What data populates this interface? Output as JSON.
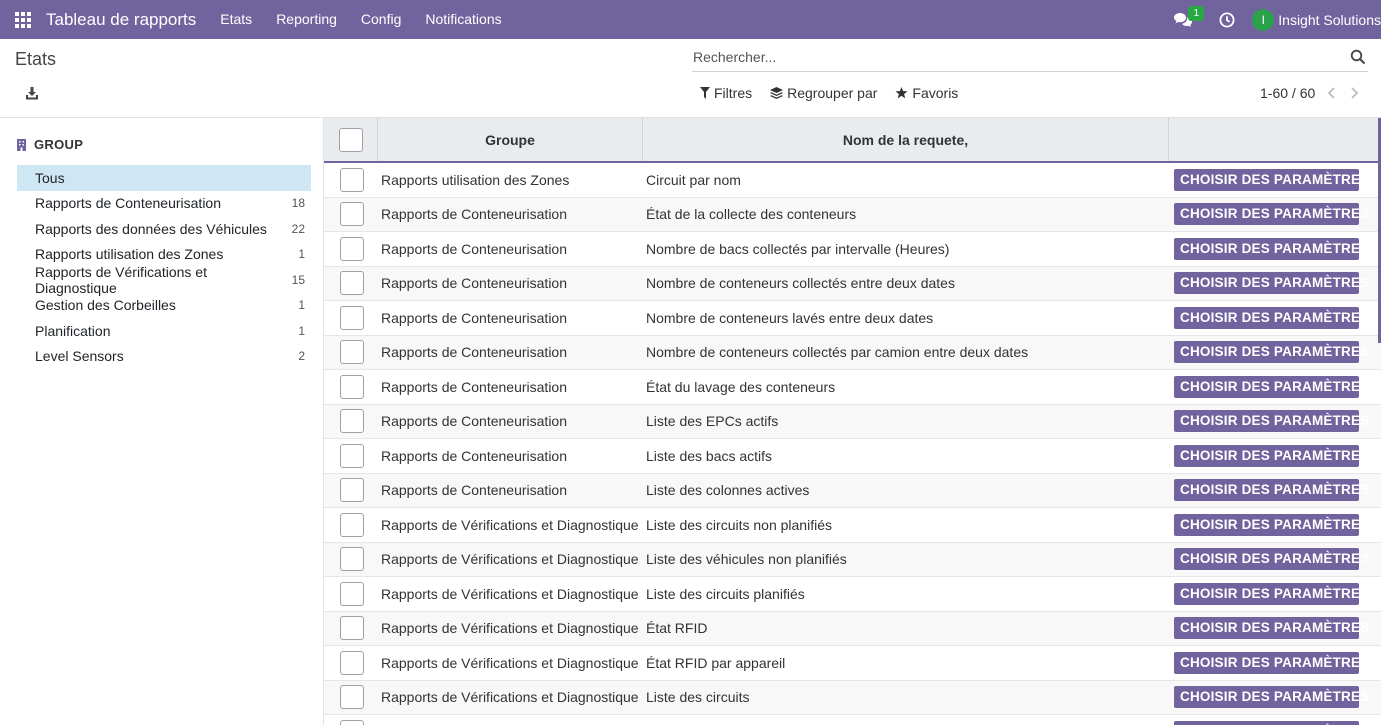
{
  "navbar": {
    "brand": "Tableau de rapports",
    "menu": [
      "Etats",
      "Reporting",
      "Config",
      "Notifications"
    ],
    "chat_badge": "1",
    "avatar_letter": "I",
    "company": "Insight Solutions",
    "color": "#71639e"
  },
  "control_panel": {
    "title": "Etats",
    "search_placeholder": "Rechercher...",
    "filters_label": "Filtres",
    "groupby_label": "Regrouper par",
    "favorites_label": "Favoris",
    "pager": "1-60 / 60"
  },
  "side_panel": {
    "header": "GROUP",
    "items": [
      {
        "label": "Tous",
        "count": "",
        "active": true
      },
      {
        "label": "Rapports de Conteneurisation",
        "count": "18"
      },
      {
        "label": "Rapports des données des Véhicules",
        "count": "22"
      },
      {
        "label": "Rapports utilisation des Zones",
        "count": "1"
      },
      {
        "label": "Rapports de Vérifications et Diagnostique",
        "count": "15"
      },
      {
        "label": "Gestion des Corbeilles",
        "count": "1"
      },
      {
        "label": "Planification",
        "count": "1"
      },
      {
        "label": "Level Sensors",
        "count": "2"
      }
    ]
  },
  "table": {
    "columns": [
      "Groupe",
      "Nom de la requete,"
    ],
    "button_label": "CHOISIR DES PARAMÈTRES",
    "rows": [
      {
        "group": "Rapports utilisation des Zones",
        "name": "Circuit par nom"
      },
      {
        "group": "Rapports de Conteneurisation",
        "name": "État de la collecte des conteneurs"
      },
      {
        "group": "Rapports de Conteneurisation",
        "name": "Nombre de bacs collectés par intervalle (Heures)"
      },
      {
        "group": "Rapports de Conteneurisation",
        "name": "Nombre de conteneurs collectés entre deux dates"
      },
      {
        "group": "Rapports de Conteneurisation",
        "name": "Nombre de conteneurs lavés entre deux dates"
      },
      {
        "group": "Rapports de Conteneurisation",
        "name": "Nombre de conteneurs collectés par camion entre deux dates"
      },
      {
        "group": "Rapports de Conteneurisation",
        "name": "État du lavage des conteneurs"
      },
      {
        "group": "Rapports de Conteneurisation",
        "name": "Liste des EPCs actifs"
      },
      {
        "group": "Rapports de Conteneurisation",
        "name": "Liste des bacs actifs"
      },
      {
        "group": "Rapports de Conteneurisation",
        "name": "Liste des colonnes actives"
      },
      {
        "group": "Rapports de Vérifications et Diagnostique",
        "name": "Liste des circuits non planifiés"
      },
      {
        "group": "Rapports de Vérifications et Diagnostique",
        "name": "Liste des véhicules non planifiés"
      },
      {
        "group": "Rapports de Vérifications et Diagnostique",
        "name": "Liste des circuits planifiés"
      },
      {
        "group": "Rapports de Vérifications et Diagnostique",
        "name": "État RFID"
      },
      {
        "group": "Rapports de Vérifications et Diagnostique",
        "name": "État RFID par appareil"
      },
      {
        "group": "Rapports de Vérifications et Diagnostique",
        "name": "Liste des circuits"
      },
      {
        "group": "",
        "name": ""
      }
    ]
  }
}
